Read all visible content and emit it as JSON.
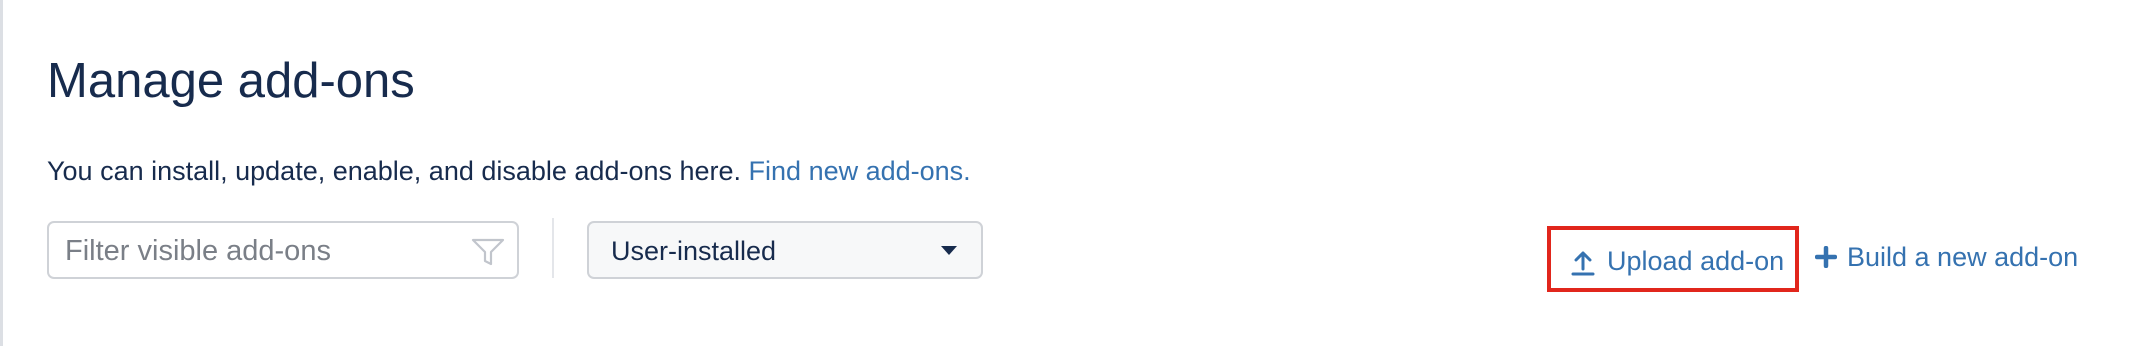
{
  "header": {
    "title": "Manage add-ons"
  },
  "intro": {
    "text": "You can install, update, enable, and disable add-ons here.",
    "link_label": "Find new add-ons."
  },
  "filter": {
    "placeholder": "Filter visible add-ons",
    "value": "",
    "icon": "filter-funnel-icon"
  },
  "scope_select": {
    "selected": "User-installed",
    "icon": "chevron-down-icon"
  },
  "actions": {
    "upload_label": "Upload add-on",
    "upload_icon": "upload-arrow-icon",
    "build_label": "Build a new add-on",
    "build_icon": "plus-icon"
  },
  "colors": {
    "heading": "#172b4d",
    "link": "#3572b0",
    "highlight": "#e1261c"
  }
}
